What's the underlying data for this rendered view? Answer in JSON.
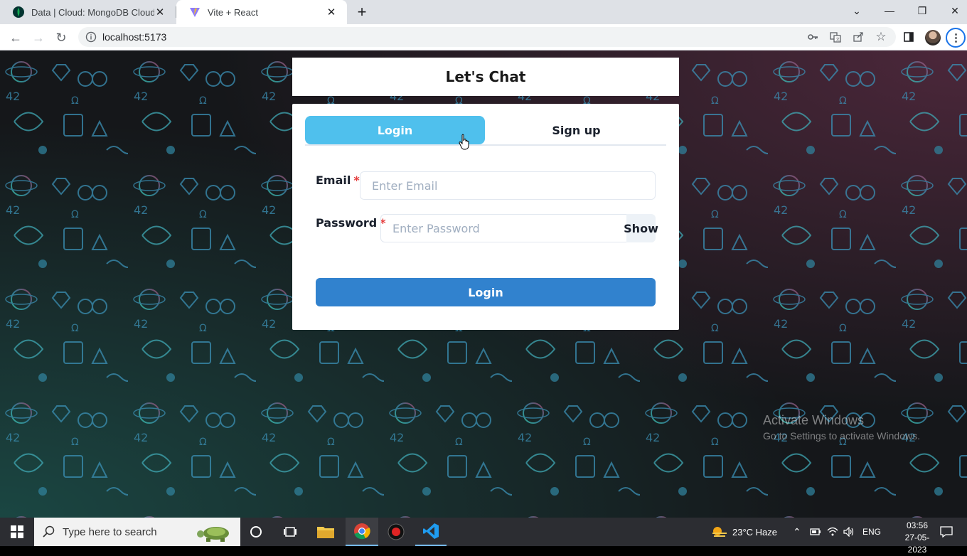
{
  "browser": {
    "tabs": [
      {
        "title": "Data | Cloud: MongoDB Cloud",
        "favicon": "mongodb-leaf-icon",
        "active": false
      },
      {
        "title": "Vite + React",
        "favicon": "vite-icon",
        "active": true
      }
    ],
    "url": "localhost:5173"
  },
  "app": {
    "title": "Let's Chat",
    "tabs": {
      "login": "Login",
      "signup": "Sign up"
    },
    "email": {
      "label": "Email",
      "required": "*",
      "placeholder": "Enter Email"
    },
    "password": {
      "label": "Password",
      "required": "*",
      "placeholder": "Enter Password",
      "toggle": "Show"
    },
    "submit": "Login",
    "colors": {
      "tab_active": "#4fc0ed",
      "submit": "#3182ce",
      "required": "#e53e3e"
    }
  },
  "watermark": {
    "line1": "Activate Windows",
    "line2": "Go to Settings to activate Windows."
  },
  "taskbar": {
    "search_placeholder": "Type here to search",
    "weather": "23°C  Haze",
    "language": "ENG",
    "time": "03:56",
    "date": "27-05-2023"
  }
}
